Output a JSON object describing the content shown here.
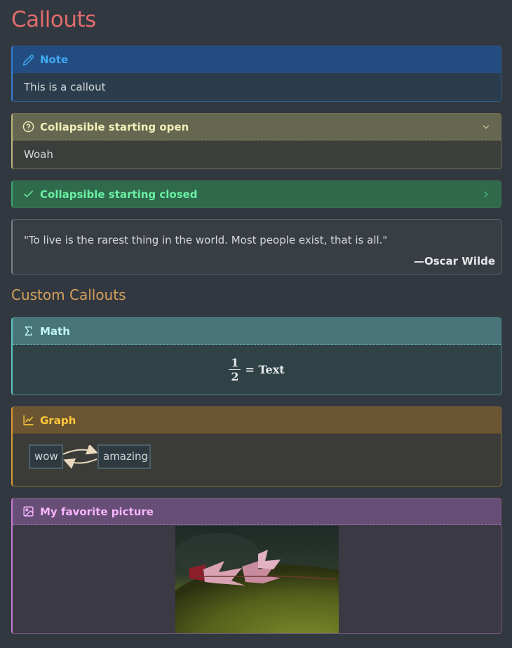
{
  "page": {
    "title": "Callouts"
  },
  "note": {
    "title": "Note",
    "body": "This is a callout",
    "icon": "pencil-icon"
  },
  "collapsible_open": {
    "title": "Collapsible starting open",
    "body": "Woah",
    "icon": "question-icon",
    "state": "expanded"
  },
  "collapsible_closed": {
    "title": "Collapsible starting closed",
    "icon": "check-icon",
    "state": "collapsed"
  },
  "quote": {
    "text": "\"To live is the rarest thing in the world. Most people exist, that is all.\"",
    "attribution": "—Oscar Wilde"
  },
  "custom_section": {
    "title": "Custom Callouts"
  },
  "math": {
    "title": "Math",
    "icon": "sigma-icon",
    "numerator": "1",
    "denominator": "2",
    "rhs": "= Text"
  },
  "graph": {
    "title": "Graph",
    "icon": "chart-icon",
    "nodes": [
      "wow",
      "amazing"
    ]
  },
  "picture": {
    "title": "My favorite picture",
    "icon": "image-icon"
  }
}
